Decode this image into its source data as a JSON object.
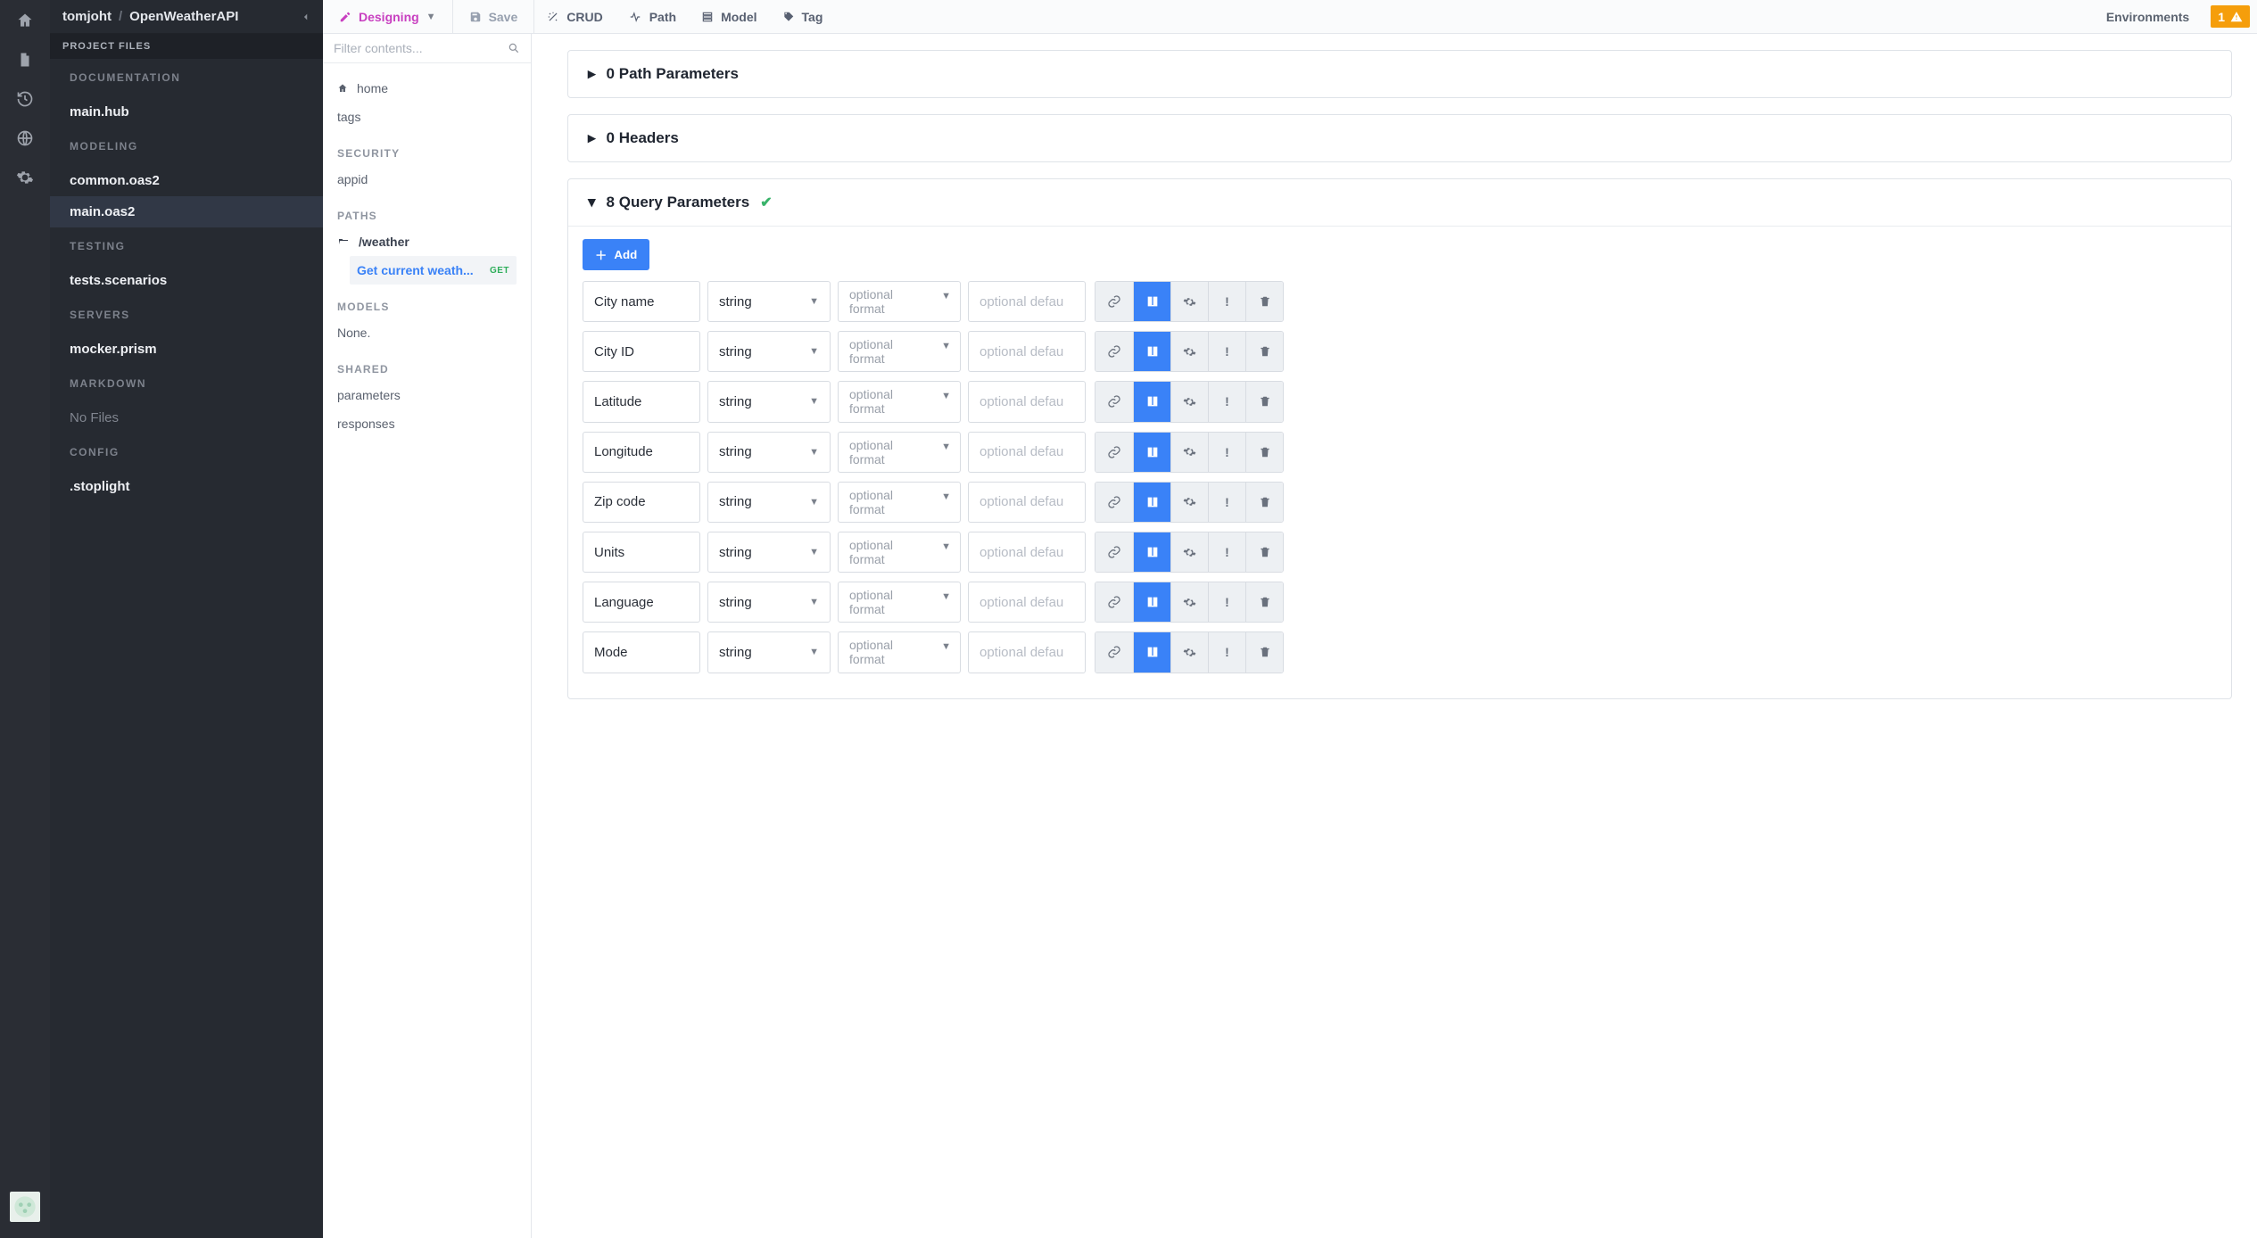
{
  "breadcrumbs": {
    "owner": "tomjoht",
    "project": "OpenWeatherAPI"
  },
  "sidebar": {
    "filesLabel": "PROJECT FILES",
    "sections": [
      {
        "label": "DOCUMENTATION",
        "items": [
          "main.hub"
        ]
      },
      {
        "label": "MODELING",
        "items": [
          "common.oas2",
          "main.oas2"
        ],
        "activeIndex": 1
      },
      {
        "label": "TESTING",
        "items": [
          "tests.scenarios"
        ]
      },
      {
        "label": "SERVERS",
        "items": [
          "mocker.prism"
        ]
      },
      {
        "label": "MARKDOWN",
        "items": [
          "No Files"
        ],
        "dim": true
      },
      {
        "label": "CONFIG",
        "items": [
          ".stoplight"
        ]
      }
    ]
  },
  "toolbar": {
    "designing": "Designing",
    "save": "Save",
    "crud": "CRUD",
    "path": "Path",
    "model": "Model",
    "tag": "Tag",
    "environments": "Environments",
    "warnCount": "1"
  },
  "contentsPanel": {
    "filterPlaceholder": "Filter contents...",
    "home": "home",
    "tags": "tags",
    "securityLabel": "SECURITY",
    "securityItems": [
      "appid"
    ],
    "pathsLabel": "PATHS",
    "pathName": "/weather",
    "endpointLabel": "Get current weath...",
    "endpointBadge": "GET",
    "modelsLabel": "MODELS",
    "modelsNone": "None.",
    "sharedLabel": "SHARED",
    "sharedItems": [
      "parameters",
      "responses"
    ]
  },
  "editor": {
    "pathParams": {
      "title": "0 Path Parameters"
    },
    "headers": {
      "title": "0 Headers"
    },
    "queryParams": {
      "title": "8 Query Parameters",
      "addLabel": "Add",
      "typeValue": "string",
      "formatPlaceholder1": "optional",
      "formatPlaceholder2": "format",
      "defaultPlaceholder": "optional defau",
      "rows": [
        {
          "name": "City name"
        },
        {
          "name": "City ID"
        },
        {
          "name": "Latitude"
        },
        {
          "name": "Longitude"
        },
        {
          "name": "Zip code"
        },
        {
          "name": "Units"
        },
        {
          "name": "Language"
        },
        {
          "name": "Mode"
        }
      ]
    }
  }
}
